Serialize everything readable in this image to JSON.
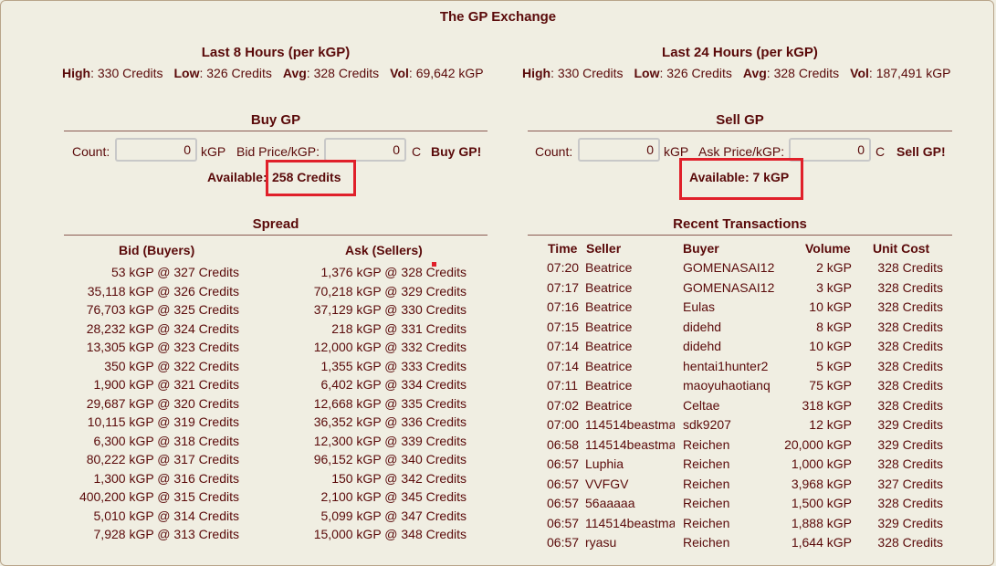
{
  "title": "The GP Exchange",
  "last8": {
    "title": "Last 8 Hours (per kGP)",
    "high_label": "High",
    "high_value": ": 330 Credits",
    "low_label": "Low",
    "low_value": ": 326 Credits",
    "avg_label": "Avg",
    "avg_value": ": 328 Credits",
    "vol_label": "Vol",
    "vol_value": ": 69,642 kGP"
  },
  "last24": {
    "title": "Last 24 Hours (per kGP)",
    "high_label": "High",
    "high_value": ": 330 Credits",
    "low_label": "Low",
    "low_value": ": 326 Credits",
    "avg_label": "Avg",
    "avg_value": ": 328 Credits",
    "vol_label": "Vol",
    "vol_value": ": 187,491 kGP"
  },
  "buy": {
    "title": "Buy GP",
    "count_label": "Count:",
    "count_value": "0",
    "count_unit": "kGP",
    "price_label": "Bid Price/kGP:",
    "price_value": "0",
    "price_unit": "C",
    "button": "Buy GP!",
    "available_label": "Available:",
    "available_value": "258 Credits"
  },
  "sell": {
    "title": "Sell GP",
    "count_label": "Count:",
    "count_value": "0",
    "count_unit": "kGP",
    "price_label": "Ask Price/kGP:",
    "price_value": "0",
    "price_unit": "C",
    "button": "Sell GP!",
    "available_text": "Available: 7 kGP"
  },
  "spread": {
    "title": "Spread",
    "bid_header": "Bid (Buyers)",
    "ask_header": "Ask (Sellers)",
    "bids": [
      "53 kGP @ 327 Credits",
      "35,118 kGP @ 326 Credits",
      "76,703 kGP @ 325 Credits",
      "28,232 kGP @ 324 Credits",
      "13,305 kGP @ 323 Credits",
      "350 kGP @ 322 Credits",
      "1,900 kGP @ 321 Credits",
      "29,687 kGP @ 320 Credits",
      "10,115 kGP @ 319 Credits",
      "6,300 kGP @ 318 Credits",
      "80,222 kGP @ 317 Credits",
      "1,300 kGP @ 316 Credits",
      "400,200 kGP @ 315 Credits",
      "5,010 kGP @ 314 Credits",
      "7,928 kGP @ 313 Credits"
    ],
    "asks": [
      "1,376 kGP @ 328 Credits",
      "70,218 kGP @ 329 Credits",
      "37,129 kGP @ 330 Credits",
      "218 kGP @ 331 Credits",
      "12,000 kGP @ 332 Credits",
      "1,355 kGP @ 333 Credits",
      "6,402 kGP @ 334 Credits",
      "12,668 kGP @ 335 Credits",
      "36,352 kGP @ 336 Credits",
      "12,300 kGP @ 339 Credits",
      "96,152 kGP @ 340 Credits",
      "150 kGP @ 342 Credits",
      "2,100 kGP @ 345 Credits",
      "5,099 kGP @ 347 Credits",
      "15,000 kGP @ 348 Credits"
    ]
  },
  "transactions": {
    "title": "Recent Transactions",
    "headers": {
      "time": "Time",
      "seller": "Seller",
      "buyer": "Buyer",
      "volume": "Volume",
      "cost": "Unit Cost"
    },
    "rows": [
      {
        "time": "07:20",
        "seller": "Beatrice",
        "buyer": "GOMENASAI12",
        "volume": "2 kGP",
        "cost": "328 Credits"
      },
      {
        "time": "07:17",
        "seller": "Beatrice",
        "buyer": "GOMENASAI12",
        "volume": "3 kGP",
        "cost": "328 Credits"
      },
      {
        "time": "07:16",
        "seller": "Beatrice",
        "buyer": "Eulas",
        "volume": "10 kGP",
        "cost": "328 Credits"
      },
      {
        "time": "07:15",
        "seller": "Beatrice",
        "buyer": "didehd",
        "volume": "8 kGP",
        "cost": "328 Credits"
      },
      {
        "time": "07:14",
        "seller": "Beatrice",
        "buyer": "didehd",
        "volume": "10 kGP",
        "cost": "328 Credits"
      },
      {
        "time": "07:14",
        "seller": "Beatrice",
        "buyer": "hentai1hunter2",
        "volume": "5 kGP",
        "cost": "328 Credits"
      },
      {
        "time": "07:11",
        "seller": "Beatrice",
        "buyer": "maoyuhaotianq",
        "volume": "75 kGP",
        "cost": "328 Credits"
      },
      {
        "time": "07:02",
        "seller": "Beatrice",
        "buyer": "Celtae",
        "volume": "318 kGP",
        "cost": "328 Credits"
      },
      {
        "time": "07:00",
        "seller": "114514beastma",
        "buyer": "sdk9207",
        "volume": "12 kGP",
        "cost": "329 Credits"
      },
      {
        "time": "06:58",
        "seller": "114514beastma",
        "buyer": "Reichen",
        "volume": "20,000 kGP",
        "cost": "329 Credits"
      },
      {
        "time": "06:57",
        "seller": "Luphia",
        "buyer": "Reichen",
        "volume": "1,000 kGP",
        "cost": "328 Credits"
      },
      {
        "time": "06:57",
        "seller": "VVFGV",
        "buyer": "Reichen",
        "volume": "3,968 kGP",
        "cost": "327 Credits"
      },
      {
        "time": "06:57",
        "seller": "56aaaaa",
        "buyer": "Reichen",
        "volume": "1,500 kGP",
        "cost": "328 Credits"
      },
      {
        "time": "06:57",
        "seller": "114514beastma",
        "buyer": "Reichen",
        "volume": "1,888 kGP",
        "cost": "329 Credits"
      },
      {
        "time": "06:57",
        "seller": "ryasu",
        "buyer": "Reichen",
        "volume": "1,644 kGP",
        "cost": "328 Credits"
      }
    ]
  },
  "colors": {
    "text": "#5a0a0a",
    "background": "#f0eee2",
    "highlight": "#e0202a"
  }
}
